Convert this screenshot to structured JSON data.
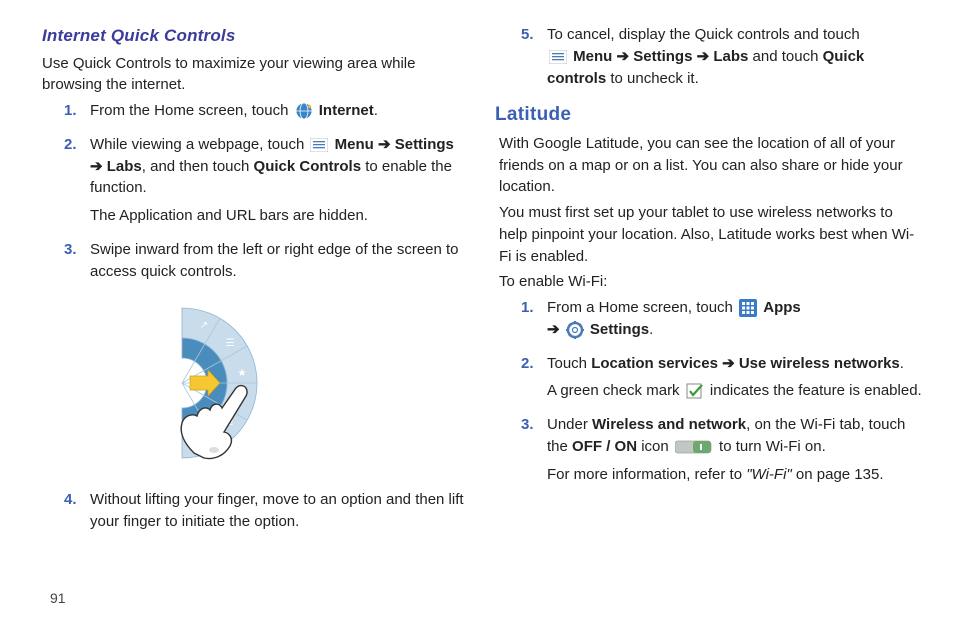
{
  "pageNumber": "91",
  "left": {
    "heading": "Internet Quick Controls",
    "intro": "Use Quick Controls to maximize your viewing area while browsing the internet.",
    "steps": [
      {
        "pre": "From the Home screen, touch ",
        "iconName": "internet-icon",
        "post": " ",
        "bold1": "Internet",
        "tail": "."
      },
      {
        "pre": "While viewing a webpage, touch ",
        "iconName": "menu-icon",
        "post": " ",
        "bold1": "Menu",
        "arrow1": " ➔ ",
        "bold2": "Settings",
        "arrow2": " ➔ ",
        "bold3": "Labs",
        "midText": ", and then touch ",
        "bold4": "Quick Controls",
        "tail": " to enable the function.",
        "note": "The Application and URL bars are hidden."
      },
      {
        "text": "Swipe inward from the left or right edge of the screen to access quick controls."
      },
      {
        "text": "Without lifting your finger, move to an option and then lift your finger to initiate the option."
      }
    ]
  },
  "right": {
    "step5": {
      "pre": "To cancel, display the Quick controls and touch ",
      "iconName": "menu-icon",
      "bold1": "Menu",
      "arrow1": " ➔ ",
      "bold2": "Settings",
      "arrow2": " ➔ ",
      "bold3": "Labs",
      "mid": " and touch ",
      "bold4": "Quick controls",
      "tail": " to uncheck it."
    },
    "heading": "Latitude",
    "p1": "With Google Latitude, you can see the location of all of your friends on a map or on a list. You can also share or hide your location.",
    "p2": "You must first set up your tablet to use wireless networks to help pinpoint your location. Also, Latitude works best when Wi-Fi is enabled.",
    "p3": "To enable Wi-Fi:",
    "steps": [
      {
        "pre": "From a Home screen, touch ",
        "iconName": "apps-icon",
        "bold1": "Apps",
        "arrow1": " ➔ ",
        "icon2Name": "settings-gear-icon",
        "bold2": "Settings",
        "tail": "."
      },
      {
        "pre": "Touch ",
        "bold1": "Location services",
        "arrow1": " ➔ ",
        "bold2": "Use wireless networks",
        "tail": ".",
        "notePre": "A green check mark ",
        "noteIcon": "checkmark-icon",
        "notePost": " indicates the feature is enabled."
      },
      {
        "pre": "Under ",
        "bold1": "Wireless and network",
        "mid1": ", on the Wi-Fi tab, touch the ",
        "bold2": "OFF / ON",
        "mid2": " icon ",
        "iconName": "toggle-on-icon",
        "tail": " to turn Wi-Fi on.",
        "refPre": "For more information, refer to ",
        "refItalic": "\"Wi-Fi\"",
        "refPost": " on page 135."
      }
    ]
  }
}
